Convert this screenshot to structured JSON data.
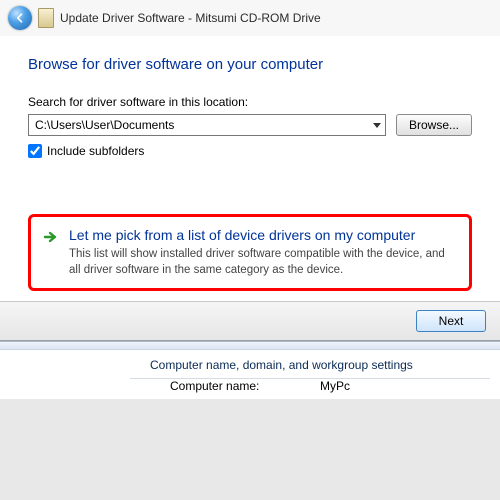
{
  "titlebar": {
    "text": "Update Driver Software - Mitsumi CD-ROM Drive"
  },
  "heading": "Browse for driver software on your computer",
  "search_label": "Search for driver software in this location:",
  "path_value": "C:\\Users\\User\\Documents",
  "browse_label": "Browse...",
  "include_subfolders_label": "Include subfolders",
  "include_subfolders_checked": true,
  "pick": {
    "title": "Let me pick from a list of device drivers on my computer",
    "desc": "This list will show installed driver software compatible with the device, and all driver software in the same category as the device."
  },
  "next_label": "Next",
  "below": {
    "section": "Computer name, domain, and workgroup settings",
    "name_k": "Computer name:",
    "name_v": "MyPc"
  }
}
